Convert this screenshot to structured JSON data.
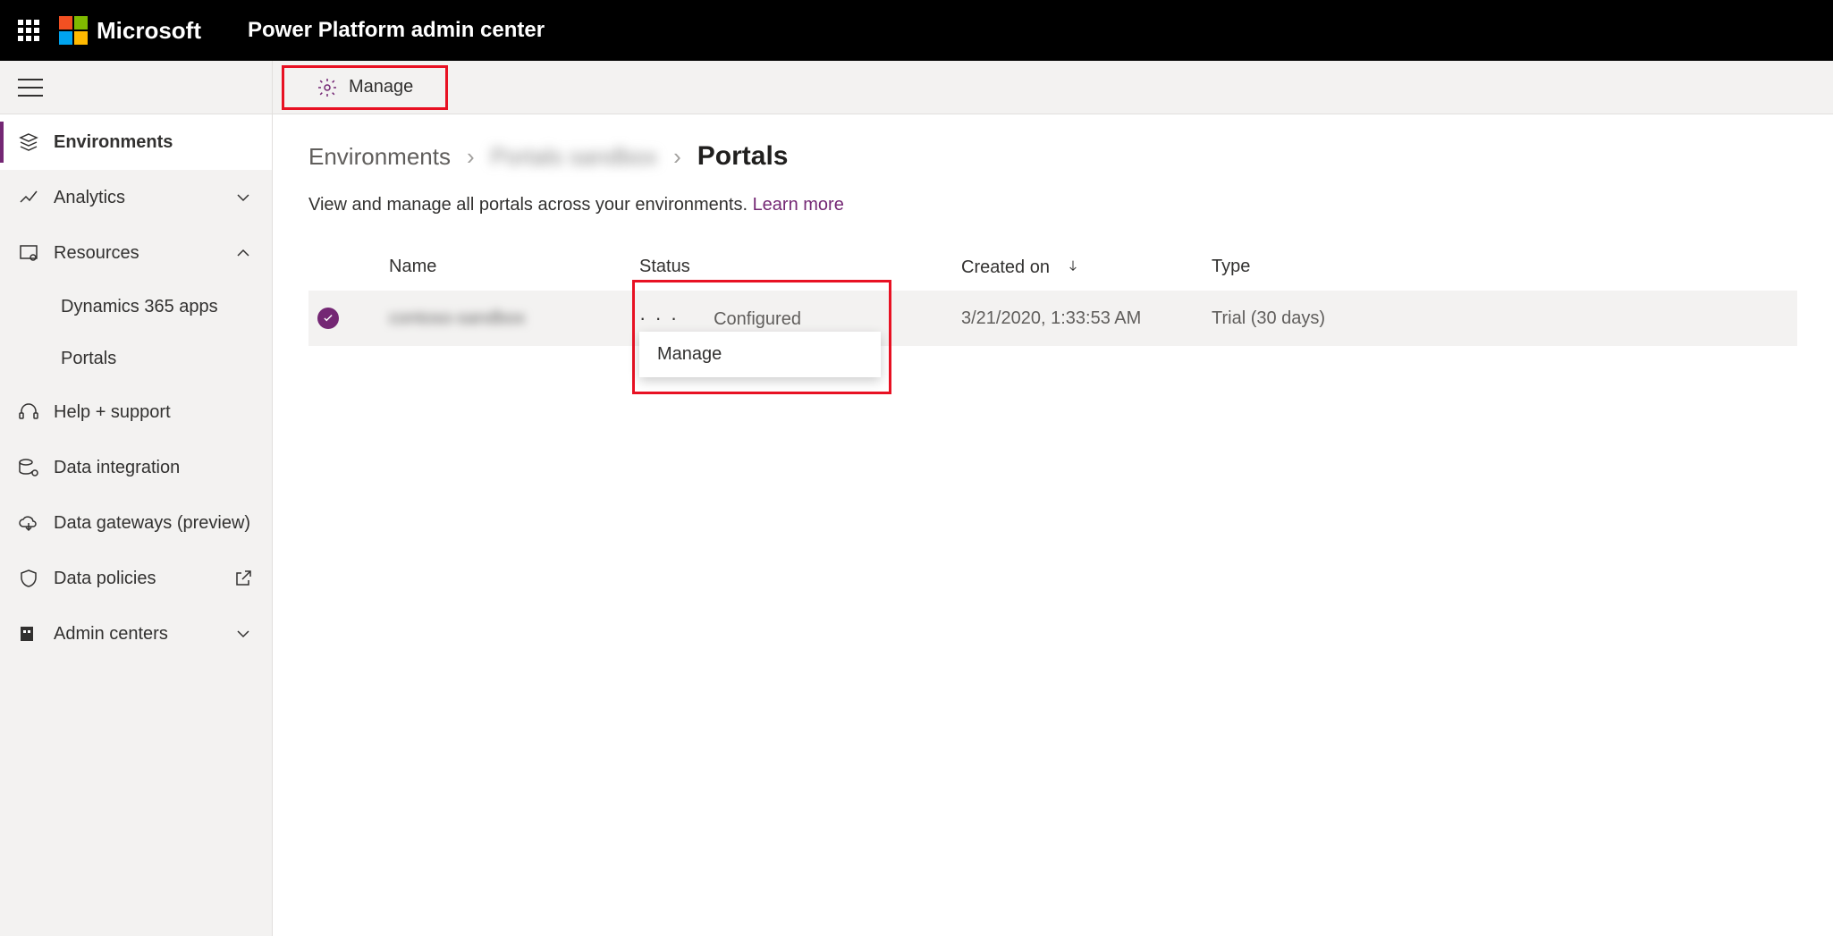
{
  "header": {
    "brand": "Microsoft",
    "app_title": "Power Platform admin center"
  },
  "sidebar": {
    "items": [
      {
        "label": "Environments"
      },
      {
        "label": "Analytics"
      },
      {
        "label": "Resources"
      },
      {
        "label": "Help + support"
      },
      {
        "label": "Data integration"
      },
      {
        "label": "Data gateways (preview)"
      },
      {
        "label": "Data policies"
      },
      {
        "label": "Admin centers"
      }
    ],
    "resources_children": {
      "dynamics": "Dynamics 365 apps",
      "portals": "Portals"
    }
  },
  "commandbar": {
    "manage": "Manage"
  },
  "breadcrumb": {
    "root": "Environments",
    "env_name": "Portals sandbox",
    "current": "Portals"
  },
  "page": {
    "description": "View and manage all portals across your environments. ",
    "learn_more": "Learn more"
  },
  "table": {
    "columns": {
      "name": "Name",
      "status": "Status",
      "created_on": "Created on",
      "type": "Type"
    },
    "rows": [
      {
        "name": "contoso-sandbox",
        "status": "Configured",
        "created_on": "3/21/2020, 1:33:53 AM",
        "type": "Trial (30 days)"
      }
    ]
  },
  "context_menu": {
    "manage": "Manage"
  }
}
